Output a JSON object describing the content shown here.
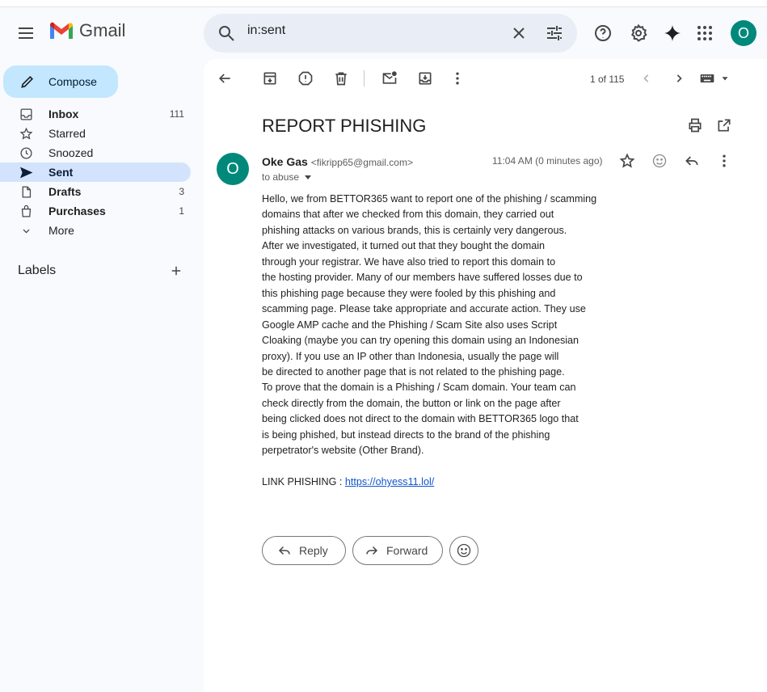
{
  "app": {
    "name": "Gmail"
  },
  "search": {
    "value": "in:sent"
  },
  "user": {
    "avatar_initial": "O"
  },
  "sidebar": {
    "compose_label": "Compose",
    "items": [
      {
        "label": "Inbox",
        "count": "111",
        "icon": "inbox-icon"
      },
      {
        "label": "Starred",
        "count": "",
        "icon": "star-icon"
      },
      {
        "label": "Snoozed",
        "count": "",
        "icon": "clock-icon"
      },
      {
        "label": "Sent",
        "count": "",
        "icon": "send-icon"
      },
      {
        "label": "Drafts",
        "count": "3",
        "icon": "draft-icon"
      },
      {
        "label": "Purchases",
        "count": "1",
        "icon": "bag-icon"
      },
      {
        "label": "More",
        "count": "",
        "icon": "chevron-down-icon"
      }
    ],
    "labels_title": "Labels"
  },
  "toolbar": {
    "pager": "1 of 115"
  },
  "message": {
    "subject": "REPORT PHISHING",
    "sender_name": "Oke Gas",
    "sender_email": "<fikripp65@gmail.com>",
    "sender_initial": "O",
    "to": "to abuse",
    "time": "11:04 AM (0 minutes ago)",
    "body_lines": [
      "Hello, we from BETTOR365 want to report one of the phishing / scamming",
      "domains that after we checked from this domain, they carried out",
      "phishing attacks on various brands, this is certainly very dangerous.",
      "After we investigated, it turned out that they bought the domain",
      "through your registrar. We have also tried to report this domain to",
      "the hosting provider. Many of our members have suffered losses due to",
      "this phishing page because they were fooled by this phishing and",
      "scamming page. Please take appropriate and accurate action. They use",
      "Google AMP cache and the Phishing / Scam Site also uses Script",
      "Cloaking (maybe you can try opening this domain using an Indonesian",
      "proxy). If you use an IP other than Indonesia, usually the page will",
      "be directed to another page that is not related to the phishing page.",
      "To prove that the domain is a Phishing / Scam domain. Your team can",
      "check directly from the domain, the button or link on the page after",
      "being clicked does not direct to the domain with BETTOR365 logo that",
      "is being phished, but instead directs to the brand of the phishing",
      "perpetrator's website (Other Brand)."
    ],
    "link_prefix": "LINK PHISHING : ",
    "link_text": "https://ohyess11.lol/",
    "reply_label": "Reply",
    "forward_label": "Forward"
  },
  "colors": {
    "accent": "#c2e7ff",
    "active_nav": "#d3e3fd",
    "avatar": "#00897b",
    "link": "#1155cc"
  }
}
